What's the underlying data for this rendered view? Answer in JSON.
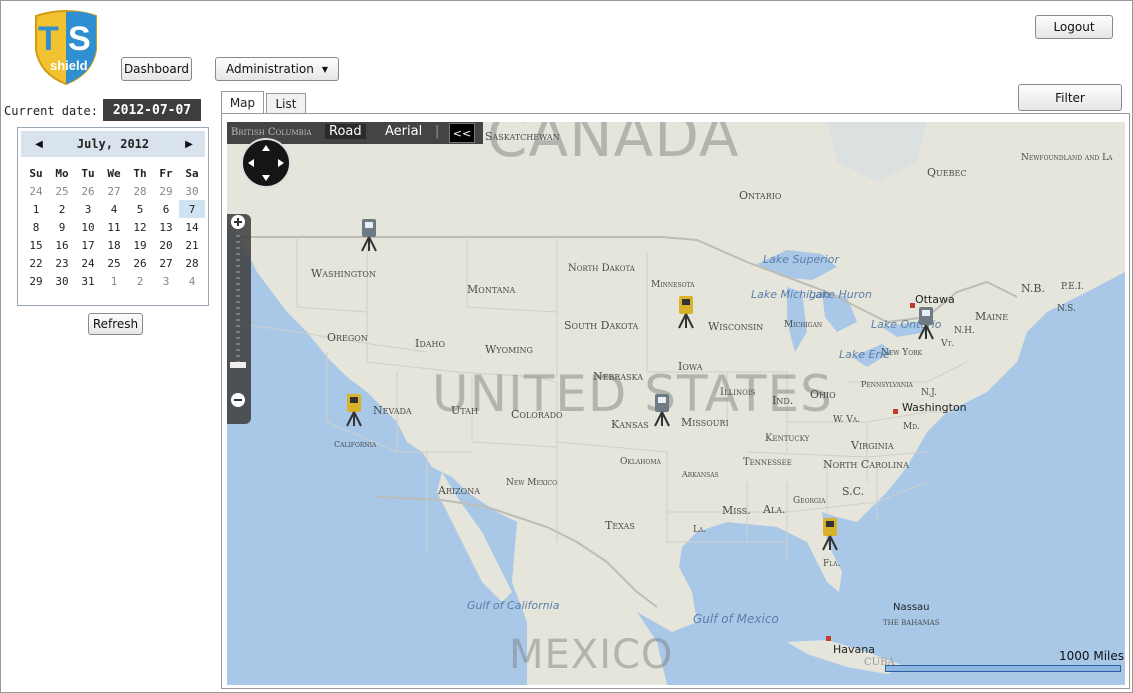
{
  "app": {
    "logo_text": "TS shield",
    "logo_mark": "shield-logo"
  },
  "header": {
    "logout_label": "Logout",
    "dashboard_label": "Dashboard",
    "administration_label": "Administration",
    "administration_caret": "▼",
    "filter_label": "Filter"
  },
  "date": {
    "label": "Current date:",
    "value": "2012-07-07"
  },
  "calendar": {
    "title": "July, 2012",
    "prev_icon": "◀",
    "next_icon": "▶",
    "weekdays": [
      "Su",
      "Mo",
      "Tu",
      "We",
      "Th",
      "Fr",
      "Sa"
    ],
    "weeks": [
      [
        "24",
        "25",
        "26",
        "27",
        "28",
        "29",
        "30"
      ],
      [
        "1",
        "2",
        "3",
        "4",
        "5",
        "6",
        "7"
      ],
      [
        "8",
        "9",
        "10",
        "11",
        "12",
        "13",
        "14"
      ],
      [
        "15",
        "16",
        "17",
        "18",
        "19",
        "20",
        "21"
      ],
      [
        "22",
        "23",
        "24",
        "25",
        "26",
        "27",
        "28"
      ],
      [
        "29",
        "30",
        "31",
        "1",
        "2",
        "3",
        "4"
      ]
    ],
    "selected": "7",
    "refresh_label": "Refresh"
  },
  "tabs": [
    {
      "label": "Map",
      "active": true
    },
    {
      "label": "List",
      "active": false
    }
  ],
  "map": {
    "mode_road": "Road",
    "mode_aerial": "Aerial",
    "mode_sep": "|",
    "collapse_icon": "<<",
    "scale_label": "1000 Miles",
    "labels": {
      "canada": "CANADA",
      "united_states": "UNITED STATES",
      "mexico": "MEXICO",
      "british_columbia": "British Columbia",
      "saskatchewan": "Saskatchewan",
      "quebec": "Quebec",
      "newfoundland": "Newfoundland and La",
      "ontario": "Ontario",
      "washington_state": "Washington",
      "montana": "Montana",
      "north_dakota": "North Dakota",
      "minnesota": "Minnesota",
      "south_dakota": "South Dakota",
      "wisconsin": "Wisconsin",
      "michigan": "Michigan",
      "oregon": "Oregon",
      "idaho": "Idaho",
      "wyoming": "Wyoming",
      "iowa": "Iowa",
      "nebraska": "Nebraska",
      "illinois": "Illinois",
      "ind": "Ind.",
      "ohio": "Ohio",
      "pennsylvania": "Pennsylvania",
      "nj": "N.J.",
      "new_york": "New York",
      "vt": "Vt.",
      "nh": "N.H.",
      "maine": "Maine",
      "nb": "N.B.",
      "pei": "P.E.I.",
      "ns": "N.S.",
      "nevada": "Nevada",
      "utah": "Utah",
      "colorado": "Colorado",
      "kansas": "Kansas",
      "missouri": "Missouri",
      "kentucky": "Kentucky",
      "wva": "W. Va.",
      "md": "Md.",
      "virginia": "Virginia",
      "california": "California",
      "oklahoma": "Oklahoma",
      "arkansas": "Arkansas",
      "tennessee": "Tennessee",
      "north_carolina": "North Carolina",
      "arizona": "Arizona",
      "new_mexico": "New Mexico",
      "sc": "S.C.",
      "georgia": "Georgia",
      "miss": "Miss.",
      "ala": "Ala.",
      "texas": "Texas",
      "la": "La.",
      "fla": "Fla.",
      "lake_superior": "Lake Superior",
      "lake_michigan": "Lake Michigan",
      "lake_huron": "Lake Huron",
      "lake_ontario": "Lake Ontario",
      "lake_erie": "Lake Erie",
      "gulf_of_california": "Gulf of California",
      "gulf_of_mexico": "Gulf of Mexico",
      "ottawa": "Ottawa",
      "washington_dc": "Washington",
      "nassau": "Nassau",
      "the_bahamas": "THE BAHAMAS",
      "havana": "Havana",
      "cuba": "CUBA"
    },
    "colors": {
      "water": "#a9c8e8",
      "land": "#e6e5dc",
      "border": "#bdbdb5"
    },
    "markers_icon": "survey-instrument-icon"
  }
}
